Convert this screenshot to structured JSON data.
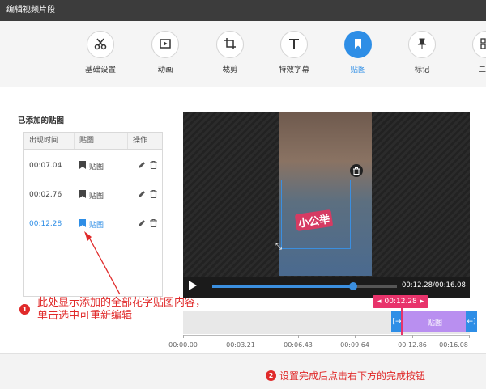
{
  "window": {
    "title": "编辑视频片段"
  },
  "toolbar": {
    "tools": [
      {
        "label": "基础设置",
        "icon": "scissors-icon"
      },
      {
        "label": "动画",
        "icon": "play-frame-icon"
      },
      {
        "label": "裁剪",
        "icon": "crop-icon"
      },
      {
        "label": "特效字幕",
        "icon": "text-icon"
      },
      {
        "label": "贴图",
        "icon": "bookmark-icon",
        "active": true
      },
      {
        "label": "标记",
        "icon": "pin-icon"
      },
      {
        "label": "二维",
        "icon": "qr-icon"
      }
    ]
  },
  "sticker_panel": {
    "title": "已添加的贴图",
    "columns": [
      "出现时间",
      "贴图",
      "操作"
    ],
    "rows": [
      {
        "time": "00:07.04",
        "name": "贴图"
      },
      {
        "time": "00:02.76",
        "name": "贴图"
      },
      {
        "time": "00:12.28",
        "name": "贴图",
        "selected": true
      }
    ]
  },
  "preview": {
    "sticker_text": "小公举",
    "timecode": "00:12.28/00:16.08",
    "progress": 0.764
  },
  "timeline": {
    "playhead_label": "00:12.28",
    "clip_label": "贴图",
    "ticks": [
      "00:00.00",
      "00:03.21",
      "00:06.43",
      "00:09.64",
      "00:12.86",
      "00:16.08"
    ]
  },
  "annotations": {
    "one": {
      "num": "1",
      "line1": "此处显示添加的全部花字贴图内容，",
      "line2": "单击选中可重新编辑"
    },
    "two": {
      "num": "2",
      "text": "设置完成后点击右下方的完成按钮"
    }
  },
  "colors": {
    "accent": "#2e8ee6",
    "annotation": "#e02a2a",
    "playhead": "#e8336b",
    "clip": "#b98ff0"
  }
}
